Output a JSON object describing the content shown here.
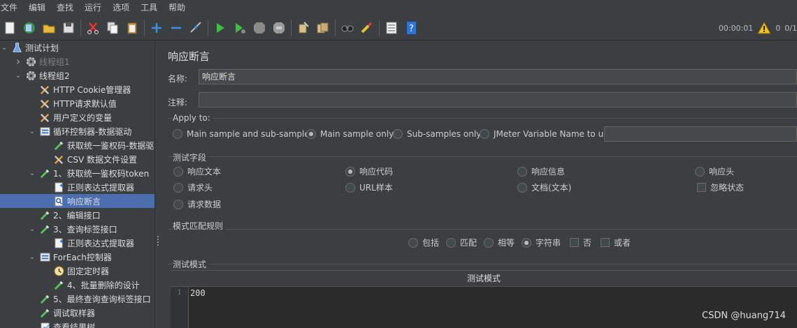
{
  "menu": [
    "文件",
    "编辑",
    "查找",
    "运行",
    "选项",
    "工具",
    "帮助"
  ],
  "toolbar": {
    "timer": "00:00:01",
    "warning_count": "0",
    "threads": "0/1"
  },
  "tree": [
    {
      "label": "测试计划",
      "icon": "flask-icon",
      "arrow": "down",
      "indent": 0
    },
    {
      "label": "线程组1",
      "icon": "gear-icon",
      "arrow": "right",
      "indent": 1,
      "disabled": true
    },
    {
      "label": "线程组2",
      "icon": "gear-icon",
      "arrow": "down",
      "indent": 1
    },
    {
      "label": "HTTP Cookie管理器",
      "icon": "tools-icon",
      "arrow": "",
      "indent": 2
    },
    {
      "label": "HTTP请求默认值",
      "icon": "tools-icon",
      "arrow": "",
      "indent": 2
    },
    {
      "label": "用户定义的变量",
      "icon": "tools-icon",
      "arrow": "",
      "indent": 2
    },
    {
      "label": "循环控制器-数据驱动",
      "icon": "controller-icon",
      "arrow": "down",
      "indent": 2
    },
    {
      "label": "获取统一鉴权码-数据驱",
      "icon": "pipette-icon",
      "arrow": "",
      "indent": 3
    },
    {
      "label": "CSV 数据文件设置",
      "icon": "tools-icon",
      "arrow": "",
      "indent": 3
    },
    {
      "label": "1、获取统一鉴权码token",
      "icon": "pipette-icon",
      "arrow": "down",
      "indent": 2
    },
    {
      "label": "正则表达式提取器",
      "icon": "extractor-icon",
      "arrow": "",
      "indent": 3
    },
    {
      "label": "响应断言",
      "icon": "magnifier-icon",
      "arrow": "",
      "indent": 3,
      "selected": true
    },
    {
      "label": "2、编辑接口",
      "icon": "pipette-icon",
      "arrow": "",
      "indent": 2
    },
    {
      "label": "3、查询标签接口",
      "icon": "pipette-icon",
      "arrow": "down",
      "indent": 2
    },
    {
      "label": "正则表达式提取器",
      "icon": "extractor-icon",
      "arrow": "",
      "indent": 3
    },
    {
      "label": "ForEach控制器",
      "icon": "controller-icon",
      "arrow": "down",
      "indent": 2
    },
    {
      "label": "固定定时器",
      "icon": "clock-icon",
      "arrow": "",
      "indent": 3
    },
    {
      "label": "4、批量删除的设计",
      "icon": "pipette-icon",
      "arrow": "",
      "indent": 3
    },
    {
      "label": "5、最终查询查询标签接口",
      "icon": "pipette-icon",
      "arrow": "",
      "indent": 2
    },
    {
      "label": "调试取样器",
      "icon": "pipette-icon",
      "arrow": "",
      "indent": 2
    },
    {
      "label": "查看结果树",
      "icon": "chart-icon",
      "arrow": "",
      "indent": 2
    }
  ],
  "panel": {
    "title": "响应断言",
    "name_label": "名称:",
    "name_value": "响应断言",
    "comment_label": "注释:",
    "comment_value": "",
    "apply_to": {
      "title": "Apply to:",
      "options": [
        "Main sample and sub-samples",
        "Main sample only",
        "Sub-samples only",
        "JMeter Variable Name to use"
      ],
      "selected": 1,
      "variable_value": ""
    },
    "test_field": {
      "title": "测试字段",
      "options": [
        "响应文本",
        "响应代码",
        "响应信息",
        "响应头",
        "请求头",
        "URL样本",
        "文档(文本)",
        "请求数据"
      ],
      "selected": 1,
      "ignore_status_label": "忽略状态",
      "ignore_status_checked": false
    },
    "match_rule": {
      "title": "模式匹配规则",
      "radio_options": [
        "包括",
        "匹配",
        "相等",
        "字符串"
      ],
      "selected": 3,
      "not_label": "否",
      "or_label": "或者"
    },
    "test_patterns": {
      "title": "测试模式",
      "column_header": "测试模式",
      "rows": [
        {
          "line": "1",
          "text": "200"
        }
      ]
    }
  },
  "watermark": "CSDN @huang714"
}
